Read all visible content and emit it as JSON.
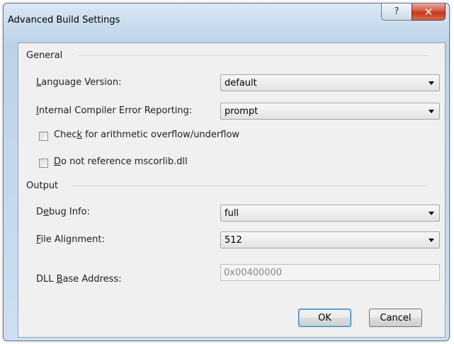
{
  "window": {
    "title": "Advanced Build Settings",
    "help_glyph": "?",
    "close_glyph": "✕"
  },
  "general": {
    "heading": "General",
    "language_version": {
      "label_accel": "L",
      "label_rest": "anguage Version:",
      "value": "default"
    },
    "ice_reporting": {
      "label_accel": "I",
      "label_rest": "nternal Compiler Error Reporting:",
      "value": "prompt"
    },
    "check_overflow": {
      "label_pre": "Chec",
      "label_accel": "k",
      "label_post": " for arithmetic overflow/underflow",
      "checked": false
    },
    "no_mscorlib": {
      "label_accel": "D",
      "label_rest": "o not reference mscorlib.dll",
      "checked": false
    }
  },
  "output": {
    "heading": "Output",
    "debug_info": {
      "label_pre": "D",
      "label_accel": "e",
      "label_post": "bug Info:",
      "value": "full"
    },
    "file_alignment": {
      "label_accel": "F",
      "label_rest": "ile Alignment:",
      "value": "512"
    },
    "dll_base": {
      "label_pre": "DLL ",
      "label_accel": "B",
      "label_post": "ase Address:",
      "value": "0x00400000"
    }
  },
  "buttons": {
    "ok": "OK",
    "cancel": "Cancel"
  },
  "icons": {
    "help": "help-icon",
    "close": "close-icon",
    "dropdown": "chevron-down-icon"
  }
}
